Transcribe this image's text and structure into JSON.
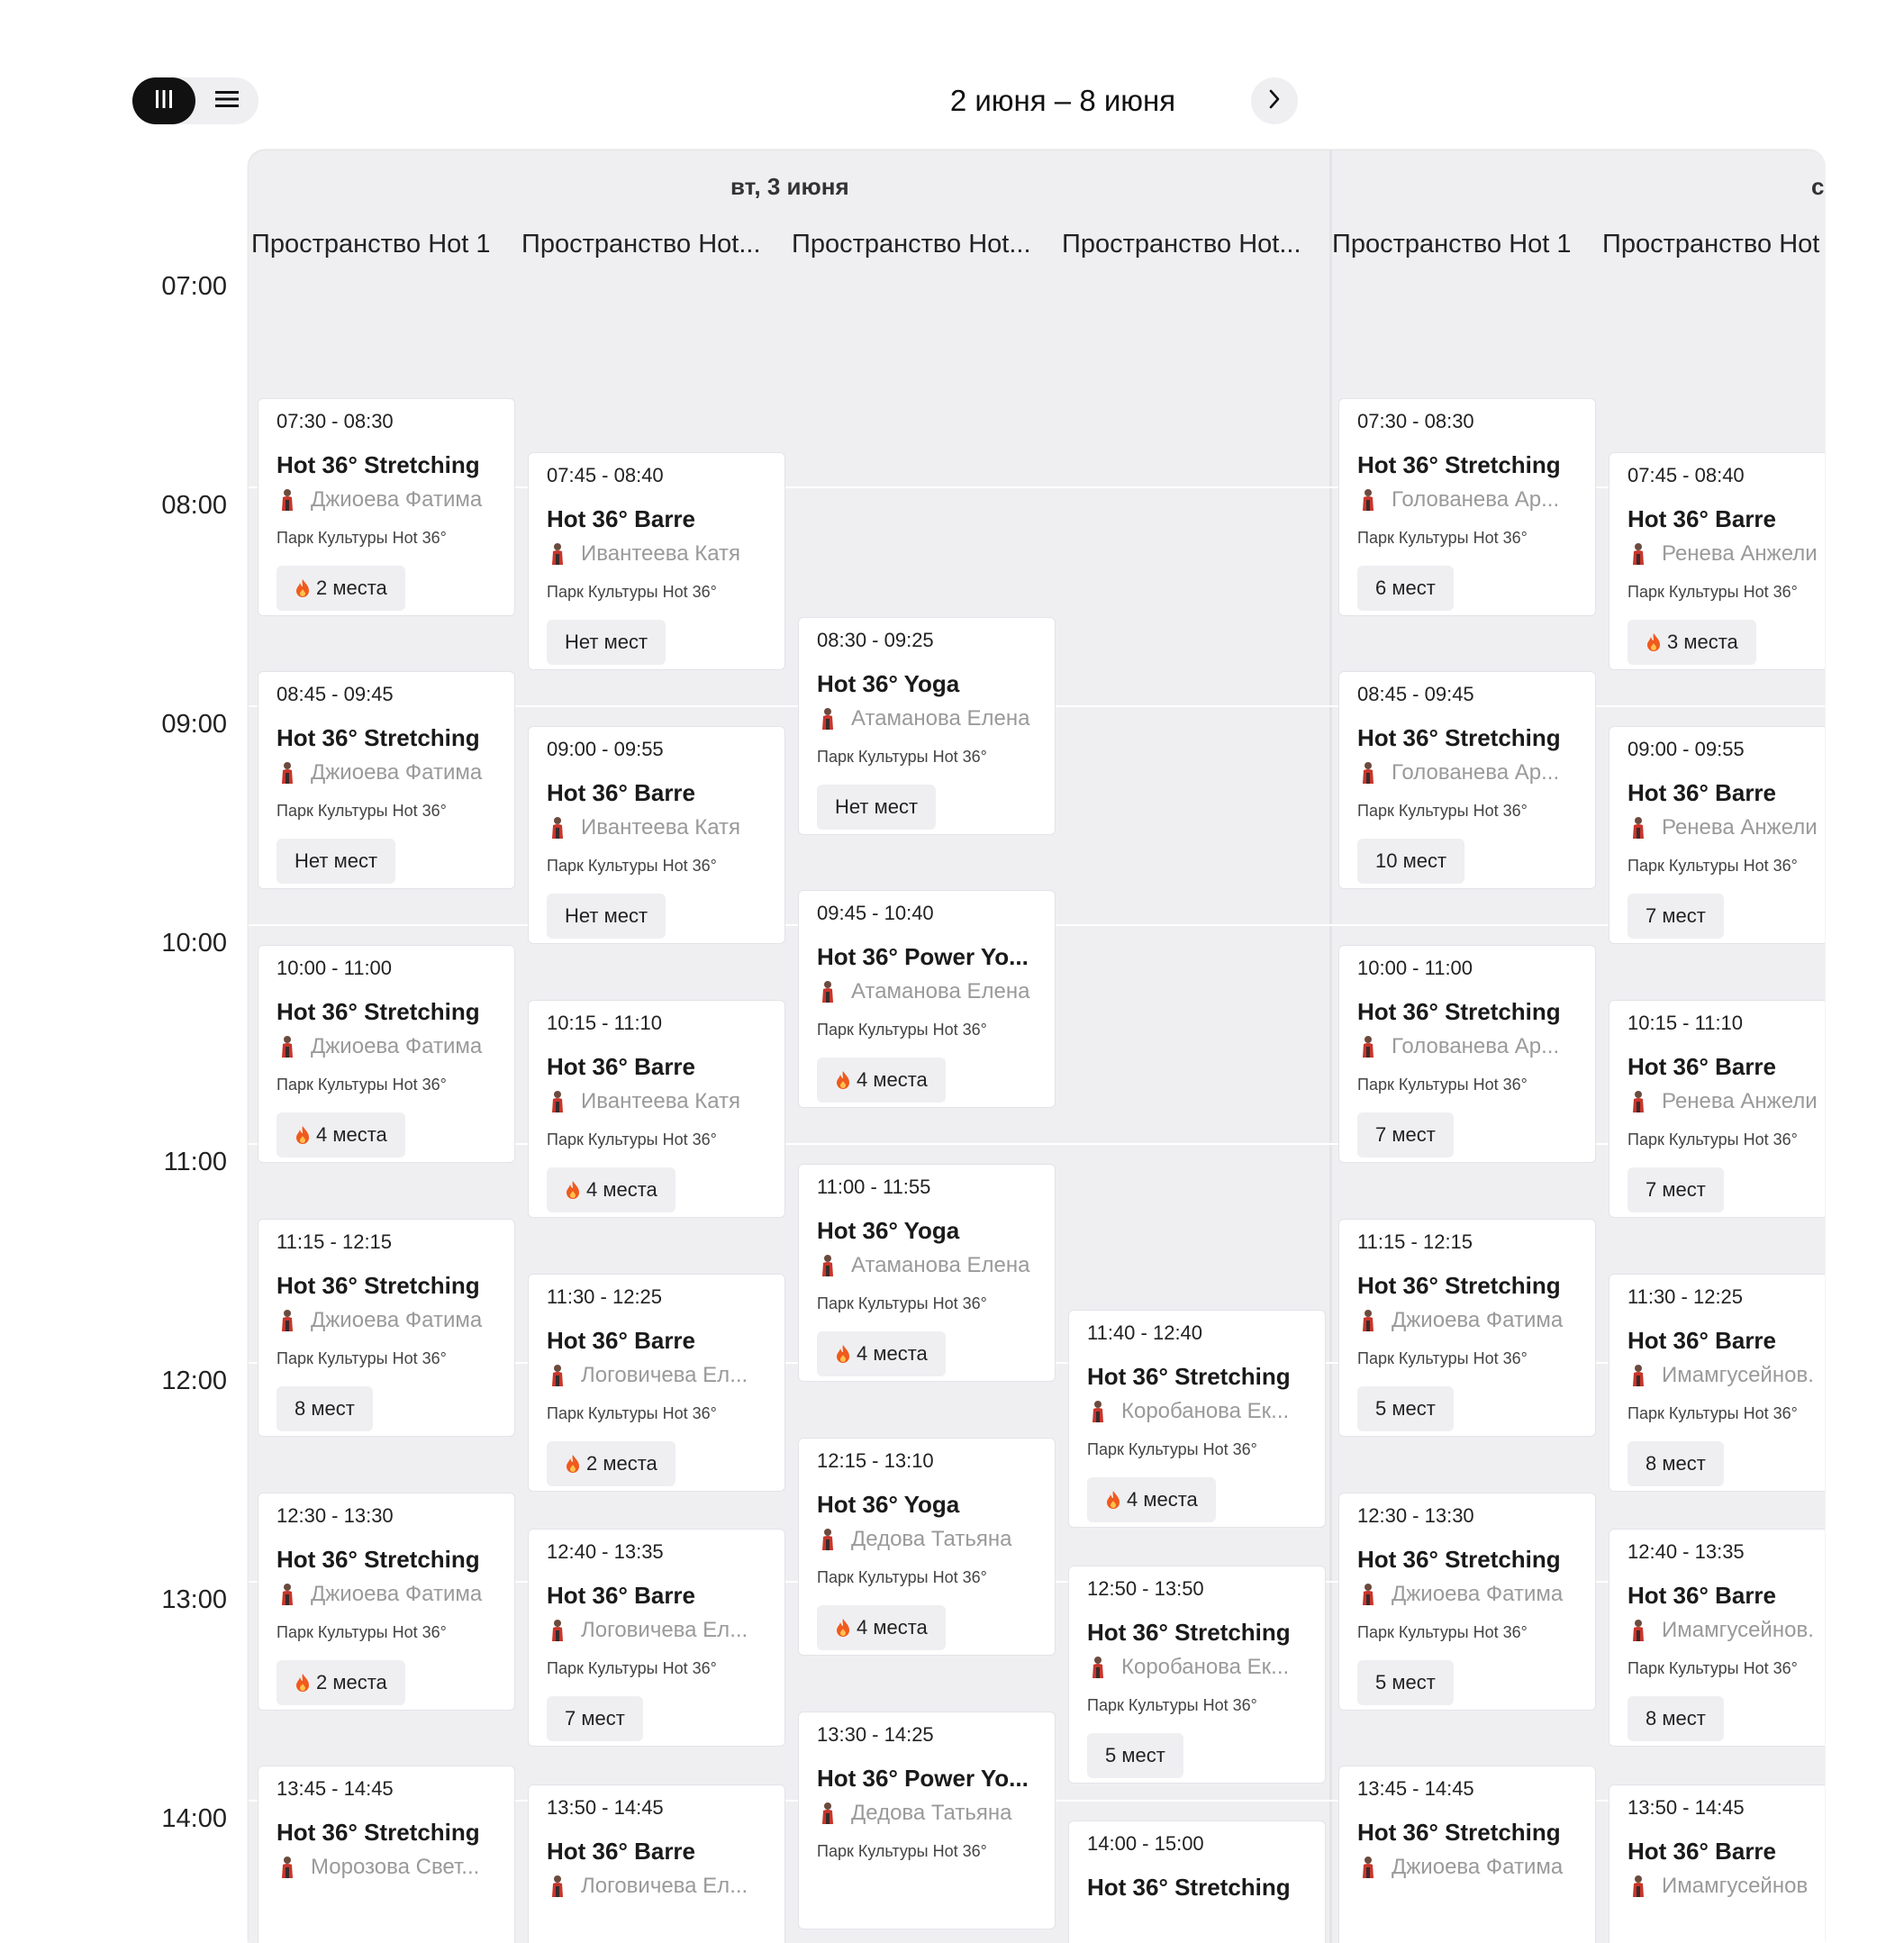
{
  "header": {
    "week_range": "2 июня – 8 июня",
    "view_toggle": {
      "calendar_icon": "columns-icon",
      "list_icon": "list-icon",
      "active": "calendar"
    },
    "next_icon": "chevron-right-icon"
  },
  "colors": {
    "active_toggle": "#111111",
    "panel_bg": "#efeff2",
    "card_bg": "#ffffff",
    "muted_text": "#9a9a9a",
    "fire": "#f05a1e"
  },
  "time_labels": [
    "07:00",
    "08:00",
    "09:00",
    "10:00",
    "11:00",
    "12:00",
    "13:00",
    "14:00"
  ],
  "days": [
    {
      "label": "вт, 3 июня",
      "rooms": [
        {
          "name": "Пространство Hot 1",
          "sessions": [
            {
              "time": "07:30 - 08:30",
              "class": "Hot 36° Stretching",
              "trainer": "Джиоева Фатима",
              "location": "Парк Культуры Hot 36°",
              "spots": "2 места",
              "hot": true
            },
            {
              "time": "08:45 - 09:45",
              "class": "Hot 36° Stretching",
              "trainer": "Джиоева Фатима",
              "location": "Парк Культуры Hot 36°",
              "spots": "Нет мест",
              "hot": false
            },
            {
              "time": "10:00 - 11:00",
              "class": "Hot 36° Stretching",
              "trainer": "Джиоева Фатима",
              "location": "Парк Культуры Hot 36°",
              "spots": "4 места",
              "hot": true
            },
            {
              "time": "11:15 - 12:15",
              "class": "Hot 36° Stretching",
              "trainer": "Джиоева Фатима",
              "location": "Парк Культуры Hot 36°",
              "spots": "8 мест",
              "hot": false
            },
            {
              "time": "12:30 - 13:30",
              "class": "Hot 36° Stretching",
              "trainer": "Джиоева Фатима",
              "location": "Парк Культуры Hot 36°",
              "spots": "2 места",
              "hot": true
            },
            {
              "time": "13:45 - 14:45",
              "class": "Hot 36° Stretching",
              "trainer": "Морозова Свет...",
              "location": "",
              "spots": "",
              "hot": false
            }
          ]
        },
        {
          "name": "Пространство Hot...",
          "sessions": [
            {
              "time": "07:45 - 08:40",
              "class": "Hot 36° Barre",
              "trainer": "Ивантеева Катя",
              "location": "Парк Культуры Hot 36°",
              "spots": "Нет мест",
              "hot": false
            },
            {
              "time": "09:00 - 09:55",
              "class": "Hot 36° Barre",
              "trainer": "Ивантеева Катя",
              "location": "Парк Культуры Hot 36°",
              "spots": "Нет мест",
              "hot": false
            },
            {
              "time": "10:15 - 11:10",
              "class": "Hot 36° Barre",
              "trainer": "Ивантеева Катя",
              "location": "Парк Культуры Hot 36°",
              "spots": "4 места",
              "hot": true
            },
            {
              "time": "11:30 - 12:25",
              "class": "Hot 36° Barre",
              "trainer": "Логовичева Ел...",
              "location": "Парк Культуры Hot 36°",
              "spots": "2 места",
              "hot": true
            },
            {
              "time": "12:40 - 13:35",
              "class": "Hot 36° Barre",
              "trainer": "Логовичева Ел...",
              "location": "Парк Культуры Hot 36°",
              "spots": "7 мест",
              "hot": false
            },
            {
              "time": "13:50 - 14:45",
              "class": "Hot 36° Barre",
              "trainer": "Логовичева Ел...",
              "location": "",
              "spots": "",
              "hot": false
            }
          ]
        },
        {
          "name": "Пространство Hot...",
          "sessions": [
            {
              "time": "08:30 - 09:25",
              "class": "Hot 36° Yoga",
              "trainer": "Атаманова Елена",
              "location": "Парк Культуры Hot 36°",
              "spots": "Нет мест",
              "hot": false
            },
            {
              "time": "09:45 - 10:40",
              "class": "Hot 36° Power Yo...",
              "trainer": "Атаманова Елена",
              "location": "Парк Культуры Hot 36°",
              "spots": "4 места",
              "hot": true
            },
            {
              "time": "11:00 - 11:55",
              "class": "Hot 36° Yoga",
              "trainer": "Атаманова Елена",
              "location": "Парк Культуры Hot 36°",
              "spots": "4 места",
              "hot": true
            },
            {
              "time": "12:15 - 13:10",
              "class": "Hot 36° Yoga",
              "trainer": "Дедова Татьяна",
              "location": "Парк Культуры Hot 36°",
              "spots": "4 места",
              "hot": true
            },
            {
              "time": "13:30 - 14:25",
              "class": "Hot 36° Power Yo...",
              "trainer": "Дедова Татьяна",
              "location": "Парк Культуры Hot 36°",
              "spots": "",
              "hot": false
            }
          ]
        },
        {
          "name": "Пространство Hot...",
          "sessions": [
            {
              "time": "11:40 - 12:40",
              "class": "Hot 36° Stretching",
              "trainer": "Коробанова Ек...",
              "location": "Парк Культуры Hot 36°",
              "spots": "4 места",
              "hot": true
            },
            {
              "time": "12:50 - 13:50",
              "class": "Hot 36° Stretching",
              "trainer": "Коробанова Ек...",
              "location": "Парк Культуры Hot 36°",
              "spots": "5 мест",
              "hot": false
            },
            {
              "time": "14:00 - 15:00",
              "class": "Hot 36° Stretching",
              "trainer": "",
              "location": "",
              "spots": "",
              "hot": false
            }
          ]
        }
      ]
    },
    {
      "label": "с",
      "rooms": [
        {
          "name": "Пространство Hot 1",
          "sessions": [
            {
              "time": "07:30 - 08:30",
              "class": "Hot 36° Stretching",
              "trainer": "Голованева Ар...",
              "location": "Парк Культуры Hot 36°",
              "spots": "6 мест",
              "hot": false
            },
            {
              "time": "08:45 - 09:45",
              "class": "Hot 36° Stretching",
              "trainer": "Голованева Ар...",
              "location": "Парк Культуры Hot 36°",
              "spots": "10 мест",
              "hot": false
            },
            {
              "time": "10:00 - 11:00",
              "class": "Hot 36° Stretching",
              "trainer": "Голованева Ар...",
              "location": "Парк Культуры Hot 36°",
              "spots": "7 мест",
              "hot": false
            },
            {
              "time": "11:15 - 12:15",
              "class": "Hot 36° Stretching",
              "trainer": "Джиоева Фатима",
              "location": "Парк Культуры Hot 36°",
              "spots": "5 мест",
              "hot": false
            },
            {
              "time": "12:30 - 13:30",
              "class": "Hot 36° Stretching",
              "trainer": "Джиоева Фатима",
              "location": "Парк Культуры Hot 36°",
              "spots": "5 мест",
              "hot": false
            },
            {
              "time": "13:45 - 14:45",
              "class": "Hot 36° Stretching",
              "trainer": "Джиоева Фатима",
              "location": "",
              "spots": "",
              "hot": false
            }
          ]
        },
        {
          "name": "Пространство Hot",
          "sessions": [
            {
              "time": "07:45 - 08:40",
              "class": "Hot 36° Barre",
              "trainer": "Ренева Анжели",
              "location": "Парк Культуры Hot 36°",
              "spots": "3 места",
              "hot": true
            },
            {
              "time": "09:00 - 09:55",
              "class": "Hot 36° Barre",
              "trainer": "Ренева Анжели",
              "location": "Парк Культуры Hot 36°",
              "spots": "7 мест",
              "hot": false
            },
            {
              "time": "10:15 - 11:10",
              "class": "Hot 36° Barre",
              "trainer": "Ренева Анжели",
              "location": "Парк Культуры Hot 36°",
              "spots": "7 мест",
              "hot": false
            },
            {
              "time": "11:30 - 12:25",
              "class": "Hot 36° Barre",
              "trainer": "Имамгусейнов.",
              "location": "Парк Культуры Hot 36°",
              "spots": "8 мест",
              "hot": false
            },
            {
              "time": "12:40 - 13:35",
              "class": "Hot 36° Barre",
              "trainer": "Имамгусейнов.",
              "location": "Парк Культуры Hot 36°",
              "spots": "8 мест",
              "hot": false
            },
            {
              "time": "13:50 - 14:45",
              "class": "Hot 36° Barre",
              "trainer": "Имамгусейнов",
              "location": "",
              "spots": "",
              "hot": false
            }
          ]
        }
      ]
    }
  ]
}
